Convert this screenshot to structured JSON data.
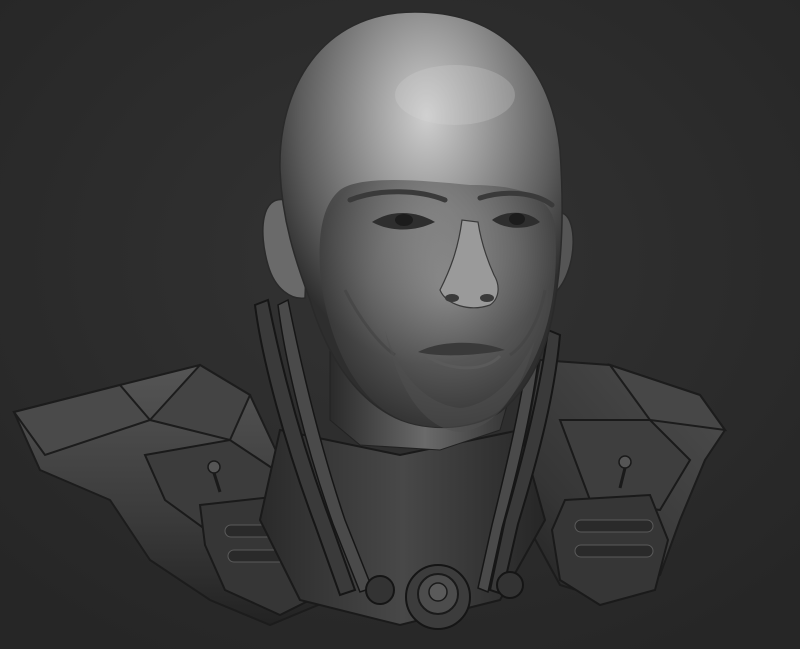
{
  "scene": {
    "subject": "bald-man-bust-sculpt",
    "material": "clay-grey",
    "colors": {
      "background": "#2b2b2b",
      "background_center": "#333333",
      "armor": "#3a3a3a",
      "armor_highlight": "#5a5a5a",
      "armor_shadow": "#1c1c1c",
      "skin": "#7a7a7a",
      "skin_highlight": "#c8c8c8",
      "skin_shadow": "#3c3c3c"
    }
  }
}
